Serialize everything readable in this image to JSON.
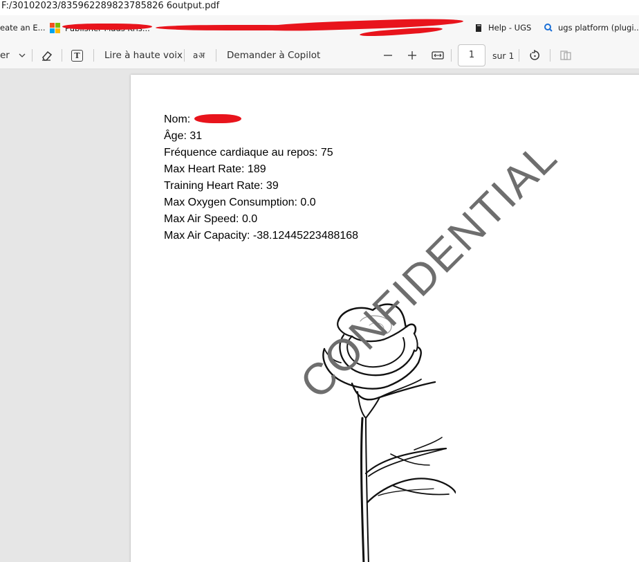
{
  "address": {
    "path": "F:/30102023/835962289823785826 6output.pdf"
  },
  "bookmarks": {
    "items": [
      {
        "label": "eate an E..."
      },
      {
        "label": "Publisher Mads Kris..."
      },
      {
        "label": "Help - UGS"
      },
      {
        "label": "ugs platform (plugi..."
      }
    ]
  },
  "toolbar": {
    "truncated_label": "er",
    "read_aloud": "Lire à haute voix",
    "copilot": "Demander à Copilot",
    "page_number": "1",
    "page_total": "sur 1"
  },
  "document": {
    "lines": [
      {
        "text": "Nom:"
      },
      {
        "text": "Âge: 31"
      },
      {
        "text": "Fréquence cardiaque au repos: 75"
      },
      {
        "text": "Max Heart Rate: 189"
      },
      {
        "text": "Training Heart Rate: 39"
      },
      {
        "text": "Max Oxygen Consumption: 0.0"
      },
      {
        "text": "Max Air Speed: 0.0"
      },
      {
        "text": "Max Air Capacity: -38.12445223488168"
      }
    ],
    "watermark": "CONFIDENTIAL"
  }
}
